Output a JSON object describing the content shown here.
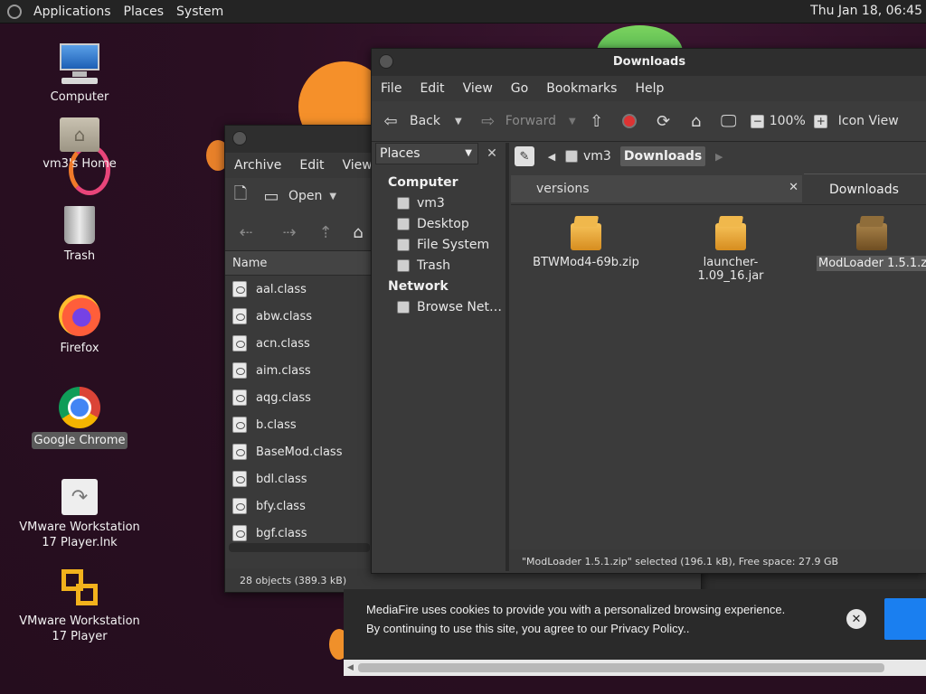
{
  "top_panel": {
    "menus": [
      "Applications",
      "Places",
      "System"
    ],
    "clock": "Thu Jan 18, 06:45"
  },
  "desktop": {
    "icons": [
      {
        "label": "Computer"
      },
      {
        "label": "vm3's Home"
      },
      {
        "label": "Trash"
      },
      {
        "label": "Firefox"
      },
      {
        "label": "Google Chrome"
      },
      {
        "label": "VMware Workstation 17 Player.lnk"
      },
      {
        "label": "VMware Workstation 17 Player"
      }
    ]
  },
  "archive_window": {
    "menus": [
      "Archive",
      "Edit",
      "View"
    ],
    "open_label": "Open",
    "column_name": "Name",
    "files": [
      "aal.class",
      "abw.class",
      "acn.class",
      "aim.class",
      "aqg.class",
      "b.class",
      "BaseMod.class",
      "bdl.class",
      "bfy.class",
      "bgf.class"
    ],
    "status": "28 objects (389.3 kB)"
  },
  "fm_window": {
    "title": "Downloads",
    "menus": [
      "File",
      "Edit",
      "View",
      "Go",
      "Bookmarks",
      "Help"
    ],
    "toolbar": {
      "back": "Back",
      "forward": "Forward",
      "zoom": "100%",
      "view_mode": "Icon View"
    },
    "sidebar": {
      "selector": "Places",
      "computer_heading": "Computer",
      "computer_items": [
        "vm3",
        "Desktop",
        "File System",
        "Trash"
      ],
      "network_heading": "Network",
      "network_items": [
        "Browse Net…"
      ]
    },
    "pathbar": [
      "vm3",
      "Downloads"
    ],
    "tabs": [
      "versions",
      "Downloads"
    ],
    "files": [
      "BTWMod4-69b.zip",
      "launcher-1.09_16.jar",
      "ModLoader 1.5.1.zip"
    ],
    "status": "\"ModLoader 1.5.1.zip\" selected (196.1 kB), Free space: 27.9 GB"
  },
  "cookie_banner": {
    "text": "MediaFire uses cookies to provide you with a personalized browsing experience. By continuing to use this site, you agree to our Privacy Policy.."
  }
}
